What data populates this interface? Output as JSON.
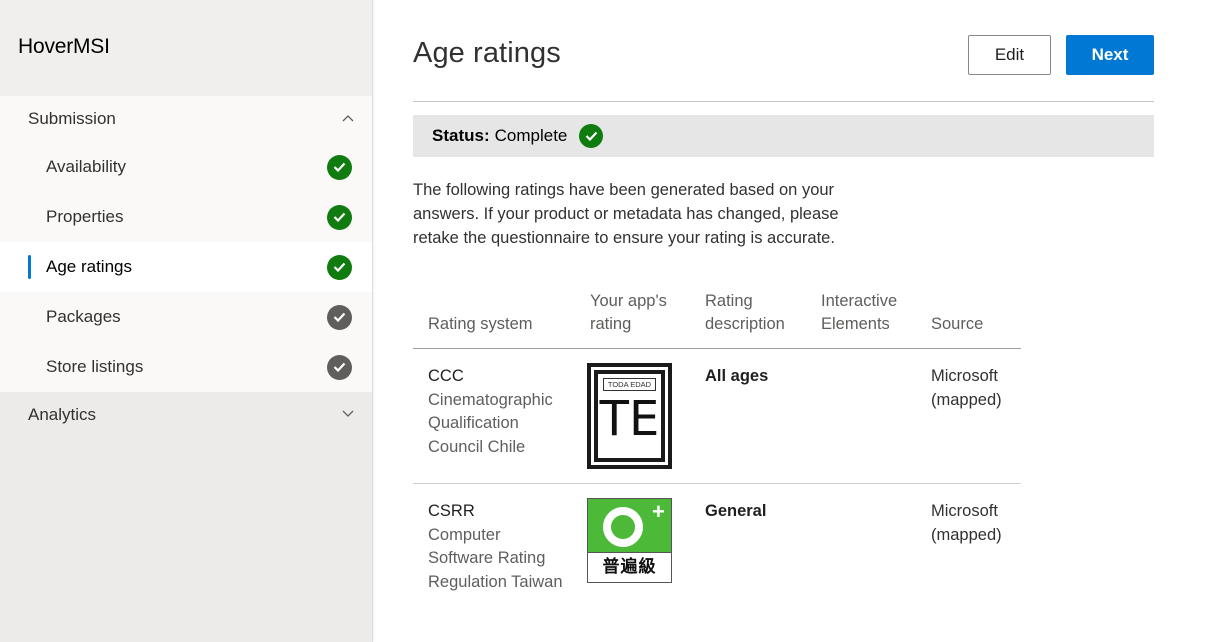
{
  "sidebar": {
    "app_title": "HoverMSI",
    "sections": [
      {
        "label": "Submission",
        "expanded": true,
        "items": [
          {
            "label": "Availability",
            "status": "complete",
            "active": false
          },
          {
            "label": "Properties",
            "status": "complete",
            "active": false
          },
          {
            "label": "Age ratings",
            "status": "complete",
            "active": true
          },
          {
            "label": "Packages",
            "status": "done-gray",
            "active": false
          },
          {
            "label": "Store listings",
            "status": "done-gray",
            "active": false
          }
        ]
      },
      {
        "label": "Analytics",
        "expanded": false
      }
    ]
  },
  "header": {
    "title": "Age ratings",
    "edit_label": "Edit",
    "next_label": "Next"
  },
  "status": {
    "label": "Status:",
    "value": "Complete"
  },
  "description": "The following ratings have been generated based on your answers. If your product or metadata has changed, please retake the questionnaire to ensure your rating is accurate.",
  "table": {
    "headers": [
      "Rating system",
      "Your app's rating",
      "Rating description",
      "Interactive Elements",
      "Source"
    ],
    "rows": [
      {
        "abbr": "CCC",
        "name": "Cinematographic Qualification Council Chile",
        "rating_logo": {
          "top_text": "TODA EDAD",
          "main_text": "TE"
        },
        "description": "All ages",
        "interactive_elements": "",
        "source": "Microsoft (mapped)"
      },
      {
        "abbr": "CSRR",
        "name": "Computer Software Rating Regulation Taiwan",
        "rating_logo": {
          "label": "普遍級",
          "symbol": "+"
        },
        "description": "General",
        "interactive_elements": "",
        "source": "Microsoft (mapped)"
      }
    ]
  },
  "colors": {
    "accent": "#0078d4",
    "success": "#107c10",
    "neutral_check": "#605e5c",
    "csrr_green": "#4cb938"
  }
}
